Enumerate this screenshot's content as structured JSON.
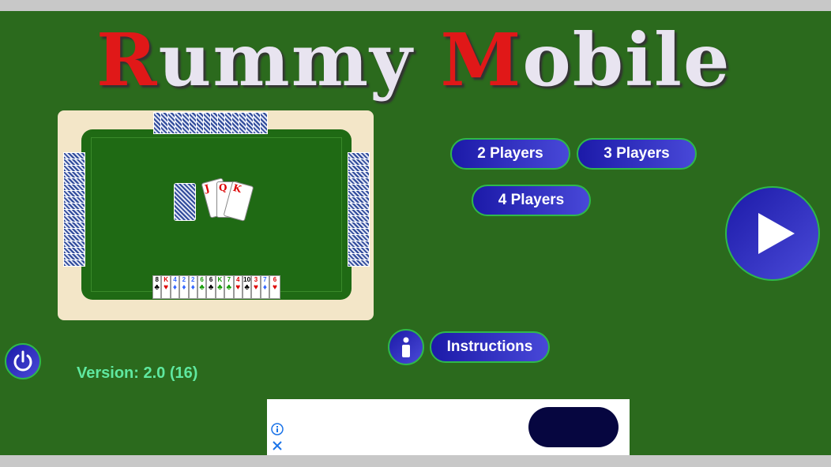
{
  "title": {
    "cap1": "R",
    "rest1": "ummy ",
    "cap2": "M",
    "rest2": "obile"
  },
  "buttons": {
    "two": "2 Players",
    "three": "3 Players",
    "four": "4 Players",
    "instructions": "Instructions"
  },
  "version": "Version: 2.0 (16)",
  "center_cards": [
    "J",
    "Q",
    "K"
  ],
  "hand": [
    {
      "r": "8",
      "s": "♣",
      "c": "#000"
    },
    {
      "r": "K",
      "s": "♥",
      "c": "#d00"
    },
    {
      "r": "4",
      "s": "♦",
      "c": "#36f"
    },
    {
      "r": "2",
      "s": "♦",
      "c": "#36f"
    },
    {
      "r": "2",
      "s": "♦",
      "c": "#36f"
    },
    {
      "r": "6",
      "s": "♣",
      "c": "#190"
    },
    {
      "r": "6",
      "s": "♣",
      "c": "#000"
    },
    {
      "r": "K",
      "s": "♣",
      "c": "#190"
    },
    {
      "r": "7",
      "s": "♣",
      "c": "#190"
    },
    {
      "r": "4",
      "s": "♥",
      "c": "#d00"
    },
    {
      "r": "10",
      "s": "♣",
      "c": "#000"
    },
    {
      "r": "3",
      "s": "♥",
      "c": "#d00"
    },
    {
      "r": "7",
      "s": "♦",
      "c": "#36f"
    },
    {
      "r": "6",
      "s": "♥",
      "c": "#d00"
    }
  ],
  "colors": {
    "felt": "#2b6a1d",
    "button": "#1c1aa8",
    "accent": "#2fb84a",
    "version": "#5fe8a0"
  }
}
